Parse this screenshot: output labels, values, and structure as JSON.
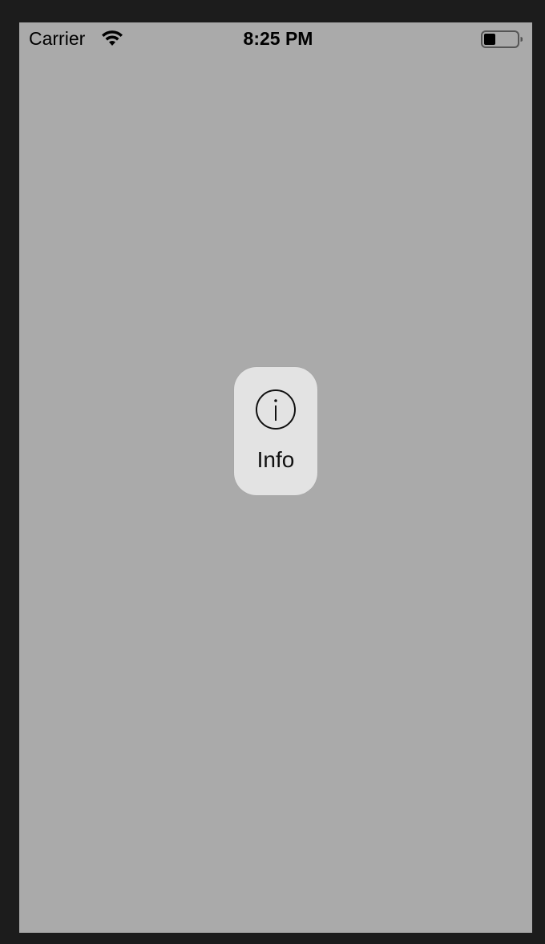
{
  "status_bar": {
    "carrier": "Carrier",
    "time": "8:25 PM",
    "wifi_icon": "wifi-icon",
    "battery_icon": "battery-icon"
  },
  "context_action": {
    "label": "Info",
    "icon": "info-circle-icon"
  },
  "colors": {
    "frame": "#1c1c1c",
    "screen_dim": "#aaaaaa",
    "action_background": "#e3e3e3",
    "text": "#000000"
  }
}
